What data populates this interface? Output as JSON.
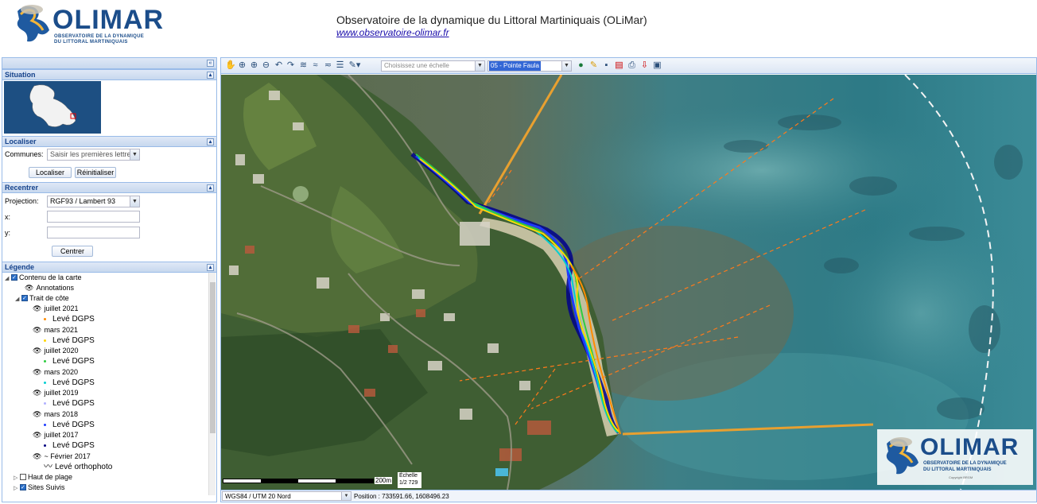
{
  "header": {
    "logo_text": "OLIMAR",
    "logo_sub1": "OBSERVATOIRE DE LA DYNAMIQUE",
    "logo_sub2": "DU LITTORAL MARTINIQUAIS",
    "title": "Observatoire de la dynamique du Littoral Martiniquais (OLiMar)",
    "link": "www.observatoire-olimar.fr"
  },
  "sidebar": {
    "collapse_glyph": "«",
    "situation": {
      "title": "Situation"
    },
    "localiser": {
      "title": "Localiser",
      "communes_label": "Communes:",
      "communes_placeholder": "Saisir les premières lettres",
      "btn_localiser": "Localiser",
      "btn_reset": "Réinitialiser"
    },
    "recentrer": {
      "title": "Recentrer",
      "projection_label": "Projection:",
      "projection_value": "RGF93 / Lambert 93",
      "x_label": "x:",
      "y_label": "y:",
      "btn_centrer": "Centrer"
    },
    "legende": {
      "title": "Légende",
      "items": [
        {
          "kind": "group",
          "label": "Contenu de la carte"
        },
        {
          "kind": "layer",
          "label": "Annotations"
        },
        {
          "kind": "group",
          "label": "Trait de côte"
        },
        {
          "kind": "layer",
          "label": "juillet 2021"
        },
        {
          "kind": "legend",
          "label": "Levé DGPS",
          "color": "#ff8c00"
        },
        {
          "kind": "layer",
          "label": "mars 2021"
        },
        {
          "kind": "legend",
          "label": "Levé DGPS",
          "color": "#ffd700"
        },
        {
          "kind": "layer",
          "label": "juillet 2020"
        },
        {
          "kind": "legend",
          "label": "Levé DGPS",
          "color": "#2ecc40"
        },
        {
          "kind": "layer",
          "label": "mars 2020"
        },
        {
          "kind": "legend",
          "label": "Levé DGPS",
          "color": "#00ced1"
        },
        {
          "kind": "layer",
          "label": "juillet 2019"
        },
        {
          "kind": "legend",
          "label": "Levé DGPS",
          "color": "#b0b0ff"
        },
        {
          "kind": "layer",
          "label": "mars 2018"
        },
        {
          "kind": "legend",
          "label": "Levé DGPS",
          "color": "#1e3cff"
        },
        {
          "kind": "layer",
          "label": "juillet 2017"
        },
        {
          "kind": "legend",
          "label": "Levé DGPS",
          "color": "#000080"
        },
        {
          "kind": "layer",
          "label": "~ Février 2017"
        },
        {
          "kind": "legend",
          "label": "Levé orthophoto",
          "color": "#000"
        },
        {
          "kind": "group2",
          "label": "Haut de plage"
        },
        {
          "kind": "group2",
          "label": "Sites Suivis"
        }
      ]
    }
  },
  "toolbar": {
    "scale_placeholder": "Choisissez une échelle",
    "site_value": "05 - Pointe Faula"
  },
  "map": {
    "scale_label": "200m",
    "echelle_label": "Échelle",
    "echelle_value": "1/2 729",
    "watermark_title": "OLIMAR",
    "watermark_sub1": "OBSERVATOIRE DE LA DYNAMIQUE",
    "watermark_sub2": "DU LITTORAL MARTINIQUAIS",
    "watermark_copy": "Copyright BRGM"
  },
  "status": {
    "projection": "WGS84 / UTM 20 Nord",
    "position": "Position : 733591.66, 1608496.23"
  }
}
